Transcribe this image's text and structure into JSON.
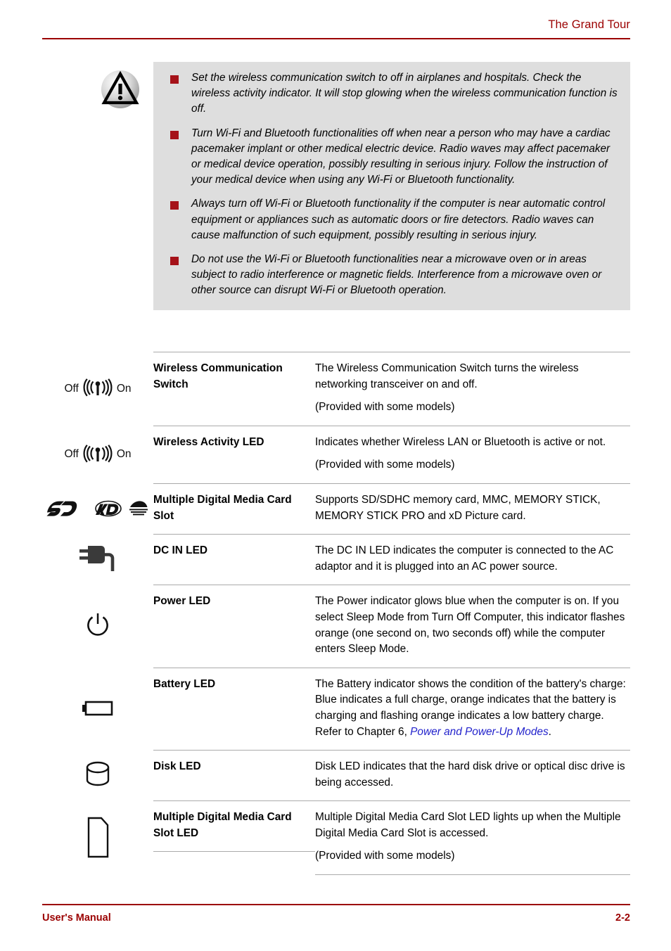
{
  "header": {
    "title": "The Grand Tour"
  },
  "caution": {
    "icon": "warning-triangle-icon",
    "bullets": [
      "Set the wireless communication switch to off in airplanes and hospitals. Check the wireless activity indicator. It will stop glowing when the wireless communication function is off.",
      "Turn Wi-Fi and Bluetooth functionalities off when near a person who may have a cardiac pacemaker implant or other medical electric device. Radio waves may affect pacemaker or medical device operation, possibly resulting in serious injury. Follow the instruction of your medical device when using any Wi-Fi or Bluetooth functionality.",
      "Always turn off Wi-Fi or Bluetooth functionality if the computer is near automatic control equipment or appliances such as automatic doors or fire detectors. Radio waves can cause malfunction of such equipment, possibly resulting in serious injury.",
      "Do not use the Wi-Fi or Bluetooth functionalities near a microwave oven or in areas subject to radio interference or magnetic fields. Interference from a microwave oven or other source can disrupt Wi-Fi or Bluetooth operation."
    ]
  },
  "wireless_switch_labels": {
    "off": "Off",
    "on": "On"
  },
  "table": {
    "rows": [
      {
        "icon": "wireless-switch-icon",
        "name": "Wireless Communication Switch",
        "paragraphs": [
          "The Wireless Communication Switch turns the wireless networking transceiver on and off.",
          "(Provided with some models)"
        ]
      },
      {
        "icon": "wireless-activity-led-icon",
        "name": "Wireless Activity LED",
        "paragraphs": [
          "Indicates whether Wireless LAN or Bluetooth is active or not.",
          "(Provided with some models)"
        ]
      },
      {
        "icon": "sd-xd-card-icon",
        "name": "Multiple Digital Media Card Slot",
        "paragraphs": [
          "Supports SD/SDHC memory card, MMC, MEMORY STICK, MEMORY STICK PRO and xD Picture card."
        ]
      },
      {
        "icon": "dc-in-plug-icon",
        "name": "DC IN LED",
        "paragraphs": [
          "The DC IN LED indicates the computer is connected to the AC adaptor and it is plugged into an AC power source."
        ]
      },
      {
        "icon": "power-icon",
        "name": "Power LED",
        "paragraphs": [
          "The Power indicator glows blue when the computer is on. If you select Sleep Mode from Turn Off Computer, this indicator flashes orange (one second on, two seconds off) while the computer enters Sleep Mode."
        ]
      },
      {
        "icon": "battery-icon",
        "name": "Battery LED",
        "paragraphs": [
          "The Battery indicator shows the condition of the battery's charge: Blue indicates a full charge, orange indicates that the battery is charging and flashing orange indicates a low battery charge. Refer to Chapter 6, "
        ],
        "link_text": "Power and Power-Up Modes",
        "link_suffix": "."
      },
      {
        "icon": "disk-drive-icon",
        "name": "Disk LED",
        "paragraphs": [
          "Disk LED indicates that the hard disk drive or optical disc drive is being accessed."
        ]
      },
      {
        "icon": "memory-card-icon",
        "name": "Multiple Digital Media Card Slot LED",
        "paragraphs": [
          "Multiple Digital Media Card Slot LED lights up when the Multiple Digital Media Card Slot is accessed.",
          "(Provided with some models)"
        ]
      }
    ]
  },
  "footer": {
    "left": "User's Manual",
    "right": "2-2"
  },
  "colors": {
    "accent_red": "#9b0000",
    "bullet_red": "#a51219",
    "caution_bg": "#dedede",
    "link_blue": "#2222cc",
    "rule_gray": "#aaaaaa"
  }
}
